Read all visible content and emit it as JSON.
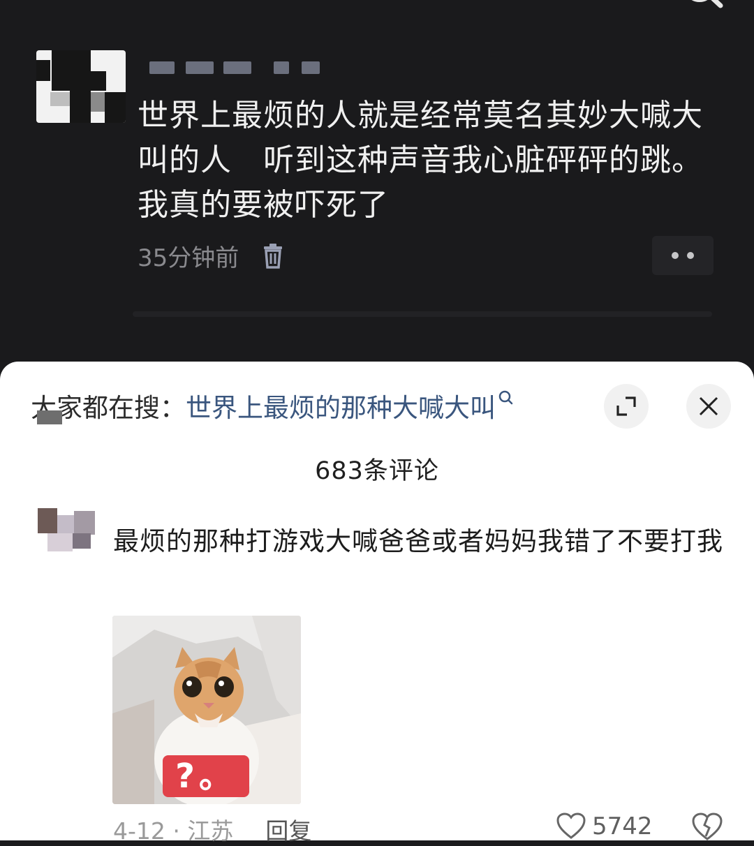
{
  "post": {
    "text": "世界上最烦的人就是经常莫名其妙大喊大叫的人　听到这种声音我心脏砰砰的跳。我真的要被吓死了",
    "time": "35分钟前"
  },
  "sheet": {
    "hot_search_label": "大家都在搜：",
    "hot_search_query": "世界上最烦的那种大喊大叫",
    "comment_count": "683条评论"
  },
  "comment": {
    "text": "最烦的那种打游戏大喊爸爸或者妈妈我错了不要打我",
    "sticker_text": "?。",
    "date_location": "4-12 · 江苏",
    "reply_label": "回复",
    "like_count": "5742"
  },
  "colors": {
    "dark_bg": "#1a1a1c",
    "sheet_bg": "#ffffff",
    "hot_query": "#3a567e",
    "badge_red": "#e1424a"
  },
  "icons": [
    "search-icon",
    "trash-icon",
    "more-icon",
    "expand-icon",
    "close-icon",
    "heart-icon",
    "broken-heart-icon"
  ]
}
